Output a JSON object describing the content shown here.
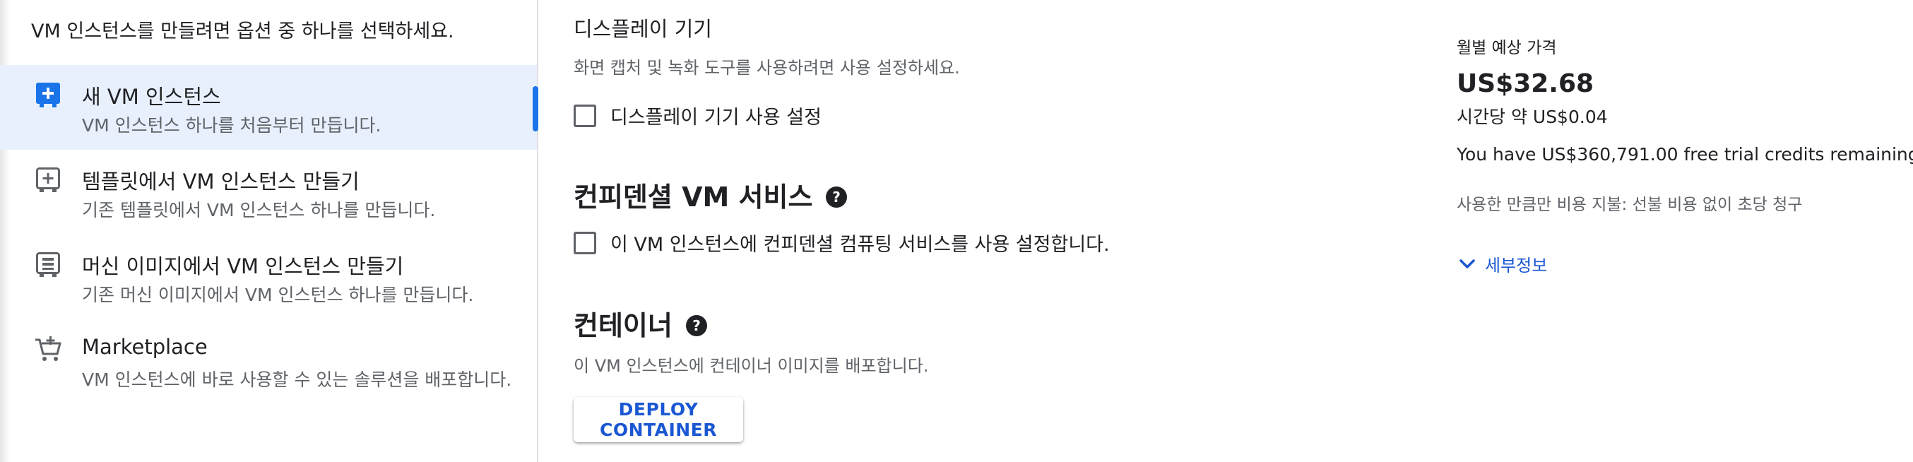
{
  "left_panel": {
    "intro": "VM 인스턴스를 만들려면 옵션 중 하나를 선택하세요.",
    "options": [
      {
        "icon": "add-box-icon",
        "title": "새 VM 인스턴스",
        "desc": "VM 인스턴스 하나를 처음부터 만듭니다.",
        "selected": true
      },
      {
        "icon": "template-add-icon",
        "title": "템플릿에서 VM 인스턴스 만들기",
        "desc": "기존 템플릿에서 VM 인스턴스 하나를 만듭니다.",
        "selected": false
      },
      {
        "icon": "machine-image-icon",
        "title": "머신 이미지에서 VM 인스턴스 만들기",
        "desc": "기존 머신 이미지에서 VM 인스턴스 하나를 만듭니다.",
        "selected": false
      },
      {
        "icon": "marketplace-cart-icon",
        "title": "Marketplace",
        "desc": "VM 인스턴스에 바로 사용할 수 있는 솔루션을 배포합니다.",
        "selected": false
      }
    ]
  },
  "display_device": {
    "title": "디스플레이 기기",
    "desc": "화면 캡처 및 녹화 도구를 사용하려면 사용 설정하세요.",
    "checkbox_label": "디스플레이 기기 사용 설정",
    "checked": false
  },
  "confidential_vm": {
    "title": "컨피덴셜 VM 서비스",
    "checkbox_label": "이 VM 인스턴스에 컨피덴셜 컴퓨팅 서비스를 사용 설정합니다.",
    "checked": false
  },
  "container": {
    "title": "컨테이너",
    "desc": "이 VM 인스턴스에 컨테이너 이미지를 배포합니다.",
    "button_label": "DEPLOY CONTAINER"
  },
  "pricing": {
    "label": "월별 예상 가격",
    "monthly": "US$32.68",
    "hourly": "시간당 약 US$0.04",
    "credits": "You have US$360,791.00 free trial credits remaining",
    "billing_note": "사용한 만큼만 비용 지불: 선불 비용 없이 초당 청구",
    "details_link": "세부정보"
  },
  "colors": {
    "accent": "#1a73e8",
    "link": "#1a57d3",
    "selected_bg": "#e8f0fe",
    "icon": "#5f6368"
  }
}
